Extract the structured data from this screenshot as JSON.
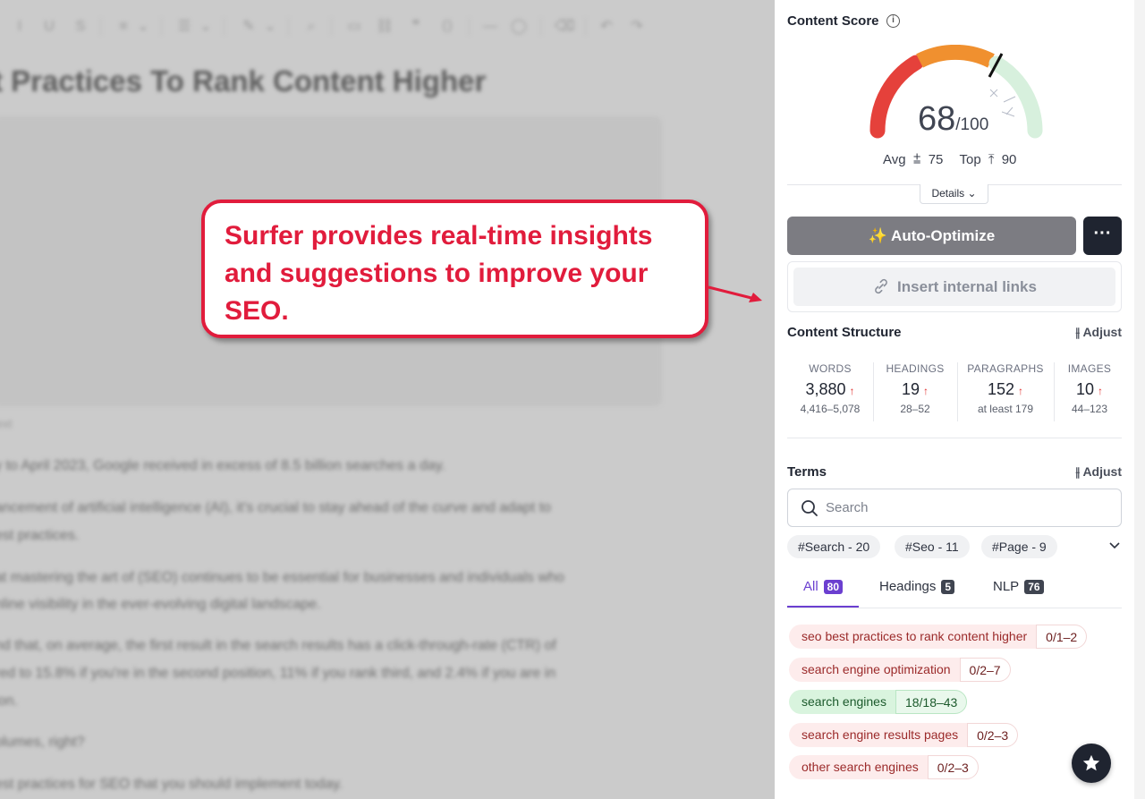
{
  "editor": {
    "title": "t Practices To Rank Content Higher",
    "caption": "ext",
    "paragraphs": [
      "y to April 2023, Google received in excess of 8.5 billion searches a day.",
      "ancement of artificial intelligence (AI), it's crucial to stay ahead of the curve and adapt to",
      "est practices.",
      "at mastering the art of (SEO) continues to be essential for businesses and individuals who",
      "nline visibility in the ever-evolving digital landscape.",
      "nd that, on average, the first result in the search results has a click-through-rate (CTR) of",
      "red to 15.8% if you're in the second position, 11% if you rank third, and 2.4% if you are in",
      "ion.",
      "olumes, right?",
      "est practices for SEO that you should implement today."
    ]
  },
  "callout": {
    "text": "Surfer provides real-time insights and suggestions to improve your SEO.",
    "color": "#e11c3c"
  },
  "panel": {
    "content_score": {
      "title": "Content Score",
      "info_icon": "i",
      "score": "68",
      "score_max": "/100",
      "score_value": 68,
      "avg_label": "Avg",
      "avg_value": "75",
      "top_label": "Top",
      "top_value": "90",
      "details_label": "Details"
    },
    "auto_optimize_label": "✨ Auto-Optimize",
    "more_label": "···",
    "insert_links_label": "Insert internal links",
    "structure": {
      "title": "Content Structure",
      "adjust_label": "Adjust",
      "stats": [
        {
          "label": "WORDS",
          "value": "3,880",
          "arrow": "↑",
          "range": "4,416–5,078"
        },
        {
          "label": "HEADINGS",
          "value": "19",
          "arrow": "↑",
          "range": "28–52"
        },
        {
          "label": "PARAGRAPHS",
          "value": "152",
          "arrow": "↑",
          "range": "at least 179"
        },
        {
          "label": "IMAGES",
          "value": "10",
          "arrow": "↑",
          "range": "44–123"
        }
      ]
    },
    "terms": {
      "title": "Terms",
      "adjust_label": "Adjust",
      "search_placeholder": "Search",
      "tags": [
        "#Search - 20",
        "#Seo - 11",
        "#Page - 9"
      ],
      "tabs": [
        {
          "label": "All",
          "count": "80"
        },
        {
          "label": "Headings",
          "count": "5"
        },
        {
          "label": "NLP",
          "count": "76"
        }
      ],
      "items": [
        {
          "name": "seo best practices to rank content higher",
          "count": "0/1–2",
          "status": "red"
        },
        {
          "name": "search engine optimization",
          "count": "0/2–7",
          "status": "red"
        },
        {
          "name": "search engines",
          "count": "18/18–43",
          "status": "green"
        },
        {
          "name": "search engine results pages",
          "count": "0/2–3",
          "status": "red"
        },
        {
          "name": "other search engines",
          "count": "0/2–3",
          "status": "red"
        }
      ]
    },
    "colors": {
      "accent": "#6b3fd0",
      "gauge_red": "#e5413b",
      "gauge_orange": "#f0902f",
      "gauge_green": "#d7f0dd"
    }
  }
}
